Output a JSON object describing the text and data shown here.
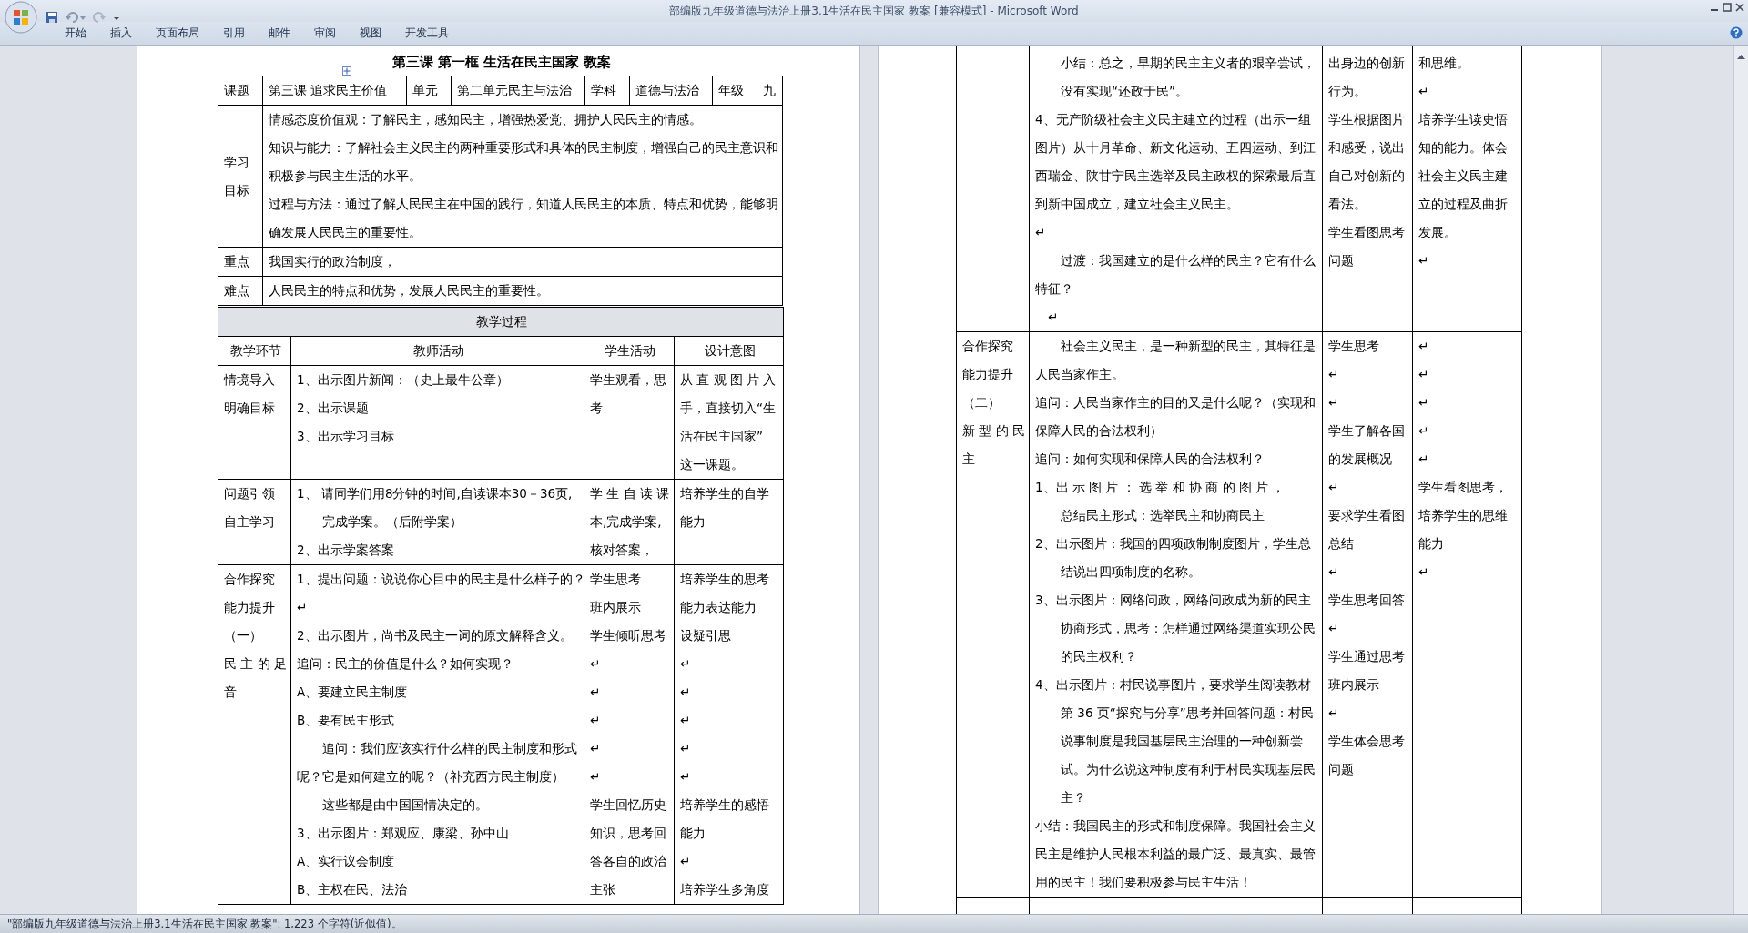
{
  "window": {
    "title": "部编版九年级道德与法治上册3.1生活在民主国家 教案 [兼容模式] - Microsoft Word"
  },
  "ribbon": {
    "tabs": [
      {
        "label": "开始",
        "selected": false
      },
      {
        "label": "插入",
        "selected": false
      },
      {
        "label": "页面布局",
        "selected": false
      },
      {
        "label": "引用",
        "selected": false
      },
      {
        "label": "邮件",
        "selected": false
      },
      {
        "label": "审阅",
        "selected": false
      },
      {
        "label": "视图",
        "selected": false
      },
      {
        "label": "开发工具",
        "selected": false
      }
    ]
  },
  "left_page": {
    "title": "第三课  第一框  生活在民主国家  教案",
    "info_row": [
      "课题",
      "第三课  追求民主价值",
      "单元",
      "第二单元民主与法治",
      "学科",
      "道德与法治",
      "年级",
      "九"
    ],
    "info_blocks": [
      {
        "label": [
          "学习",
          "目标"
        ],
        "lines": [
          "情感态度价值观：了解民主，感知民主，增强热爱党、拥护人民民主的情感。",
          "知识与能力：了解社会主义民主的两种重要形式和具体的民主制度，增强自己的民主意识和",
          "积极参与民主生活的水平。",
          "过程与方法：通过了解人民民主在中国的践行，知道人民民主的本质、特点和优势，能够明",
          "确发展人民民主的重要性。"
        ]
      },
      {
        "label": [
          "重点"
        ],
        "lines": [
          "我国实行的政治制度，"
        ]
      },
      {
        "label": [
          "难点"
        ],
        "lines": [
          "人民民主的特点和优势，发展人民民主的重要性。"
        ]
      }
    ],
    "process": {
      "heading": "教学过程",
      "columns": [
        "教学环节",
        "教师活动",
        "学生活动",
        "设计意图"
      ],
      "rows": [
        {
          "cells": [
            {
              "lines": [
                "情境导入",
                "明确目标"
              ]
            },
            {
              "lines": [
                "1、出示图片新闻：（史上最牛公章）",
                "2、出示课题",
                "3、出示学习目标"
              ]
            },
            {
              "lines": [
                "学生观看，思",
                "考"
              ]
            },
            {
              "lines": [
                " 从 直 观 图 片 入",
                "手，直接切入“生",
                "活在民主国家”",
                "这一课题。"
              ]
            }
          ]
        },
        {
          "cells": [
            {
              "lines": [
                "问题引领",
                "自主学习"
              ]
            },
            {
              "lines": [
                "1、 请同学们用8分钟的时间,自读课本30－36页,",
                "　　完成学案。（后附学案）",
                "2、出示学案答案"
              ]
            },
            {
              "lines": [
                "学 生 自 读 课",
                "本,完成学案,",
                "核对答案，"
              ]
            },
            {
              "lines": [
                "培养学生的自学",
                "能力"
              ]
            }
          ]
        },
        {
          "cells": [
            {
              "lines": [
                "合作探究",
                "能力提升",
                "（一）",
                "民 主 的 足",
                "音"
              ]
            },
            {
              "lines": [
                "1、提出问题：说说你心目中的民主是什么样子的？",
                "↵",
                "2、出示图片，尚书及民主一词的原文解释含义。",
                "追问：民主的价值是什么？如何实现？",
                "A、要建立民主制度",
                "B、要有民主形式",
                "　　追问：我们应该实行什么样的民主制度和形式",
                "呢？它是如何建立的呢？（补充西方民主制度）",
                "　　这些都是由中国国情决定的。",
                "3、出示图片：郑观应、康梁、孙中山",
                "A、实行议会制度",
                "B、主权在民、法治"
              ]
            },
            {
              "lines": [
                "学生思考",
                "班内展示",
                "学生倾听思考",
                "↵",
                "↵",
                "↵",
                "↵",
                "↵",
                "学生回忆历史",
                "知识，思考回",
                "答各自的政治",
                "主张"
              ]
            },
            {
              "lines": [
                "培养学生的思考",
                "能力表达能力",
                "设疑引思",
                "↵",
                "↵",
                "↵",
                "↵",
                "↵",
                "培养学生的感悟",
                "能力",
                "↵",
                "培养学生多角度"
              ]
            }
          ]
        }
      ]
    }
  },
  "right_page": {
    "rows": [
      {
        "cells": [
          {},
          {
            "lines": [
              "　　小结：总之，早期的民主主义者的艰辛尝试，",
              "　　没有实现“还政于民”。",
              "4、无产阶级社会主义民主建立的过程（出示一组",
              "图片）从十月革命、新文化运动、五四运动、到江",
              "西瑞金、陕甘宁民主选举及民主政权的探索最后直",
              "到新中国成立，建立社会主义民主。",
              "↵",
              "　　过渡：我国建立的是什么样的民主？它有什么",
              "特征？",
              "　↵"
            ]
          },
          {
            "lines": [
              "出身边的创新",
              "行为。",
              "学生根据图片",
              "和感受，说出",
              "自己对创新的",
              "看法。",
              "学生看图思考",
              "问题"
            ]
          },
          {
            "lines": [
              "和思维。",
              "↵",
              "培养学生读史悟",
              "知的能力。体会",
              "社会主义民主建",
              "立的过程及曲折",
              "发展。",
              "↵"
            ]
          }
        ]
      },
      {
        "cells": [
          {
            "lines": [
              "合作探究",
              "能力提升",
              "（二）",
              "新 型 的 民",
              "主"
            ]
          },
          {
            "lines": [
              "　　社会主义民主，是一种新型的民主，其特征是",
              "人民当家作主。",
              "追问：人民当家作主的目的又是什么呢？（实现和",
              "保障人民的合法权利）",
              "追问：如何实现和保障人民的合法权利？",
              "1、出 示 图 片 ： 选 举 和 协 商 的 图 片 ，",
              "　　总结民主形式：选举民主和协商民主",
              "2、出示图片：我国的四项政制制度图片，学生总",
              "　　结说出四项制度的名称。",
              "3、出示图片：网络问政，网络问政成为新的民主",
              "　　协商形式，思考：怎样通过网络渠道实现公民",
              "　　的民主权利？",
              "4、出示图片：村民说事图片，要求学生阅读教材",
              "　　第 36 页“探究与分享”思考并回答问题：村民",
              "　　说事制度是我国基层民主治理的一种创新尝",
              "　　试。为什么说这种制度有利于村民实现基层民",
              "　　主？",
              "小结：我国民主的形式和制度保障。我国社会主义",
              "民主是维护人民根本利益的最广泛、最真实、最管",
              "用的民主！我们要积极参与民主生活！"
            ]
          },
          {
            "lines": [
              "学生思考",
              "↵",
              "↵",
              "学生了解各国",
              "的发展概况",
              "↵",
              "要求学生看图",
              "总结",
              "↵",
              "学生思考回答",
              "↵",
              "学生通过思考",
              "班内展示",
              "↵",
              "学生体会思考",
              "问题"
            ]
          },
          {
            "lines": [
              "↵",
              "↵",
              "↵",
              "↵",
              "↵",
              "学生看图思考，",
              "培养学生的思维",
              "能力",
              "↵"
            ]
          }
        ]
      }
    ]
  },
  "status_bar": {
    "text": "\"部编版九年级道德与法治上册3.1生活在民主国家 教案\": 1,223 个字符(近似值)。"
  }
}
